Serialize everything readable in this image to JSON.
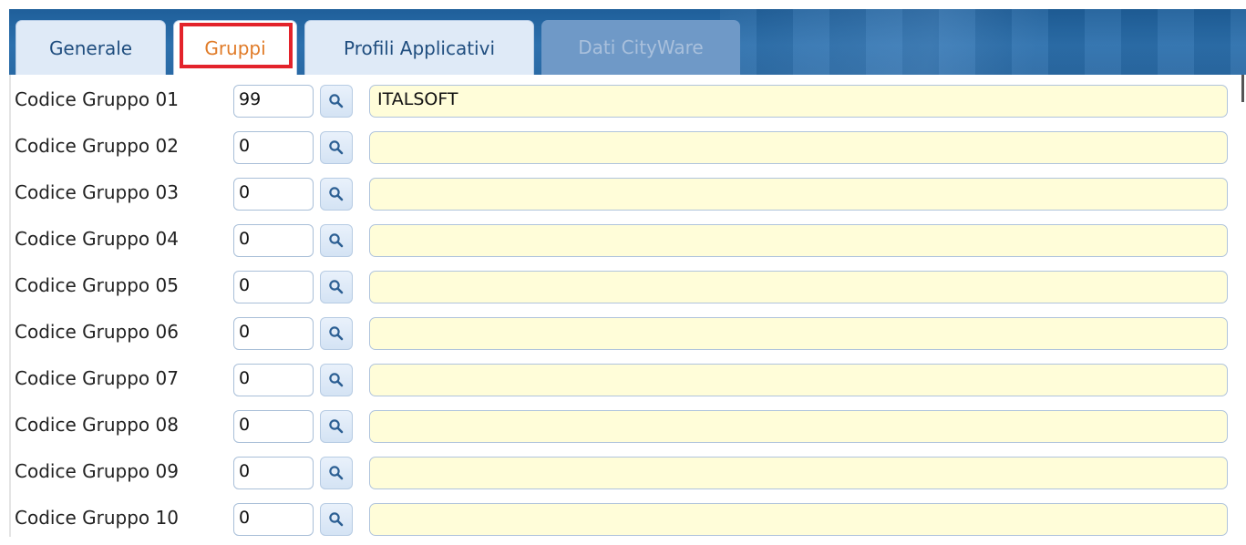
{
  "tabs": [
    {
      "label": "Generale",
      "state": "normal"
    },
    {
      "label": "Gruppi",
      "state": "active"
    },
    {
      "label": "Profili Applicativi",
      "state": "normal"
    },
    {
      "label": "Dati CityWare",
      "state": "disabled"
    }
  ],
  "rows": [
    {
      "label": "Codice Gruppo 01",
      "code": "99",
      "description": "ITALSOFT"
    },
    {
      "label": "Codice Gruppo 02",
      "code": "0",
      "description": ""
    },
    {
      "label": "Codice Gruppo 03",
      "code": "0",
      "description": ""
    },
    {
      "label": "Codice Gruppo 04",
      "code": "0",
      "description": ""
    },
    {
      "label": "Codice Gruppo 05",
      "code": "0",
      "description": ""
    },
    {
      "label": "Codice Gruppo 06",
      "code": "0",
      "description": ""
    },
    {
      "label": "Codice Gruppo 07",
      "code": "0",
      "description": ""
    },
    {
      "label": "Codice Gruppo 08",
      "code": "0",
      "description": ""
    },
    {
      "label": "Codice Gruppo 09",
      "code": "0",
      "description": ""
    },
    {
      "label": "Codice Gruppo 10",
      "code": "0",
      "description": ""
    }
  ],
  "icons": {
    "search": "search-icon"
  },
  "colors": {
    "tab_bar": "#2c70ad",
    "active_tab_text": "#e07b28",
    "highlight_box": "#e3232b",
    "description_bg": "#fffdd9"
  }
}
